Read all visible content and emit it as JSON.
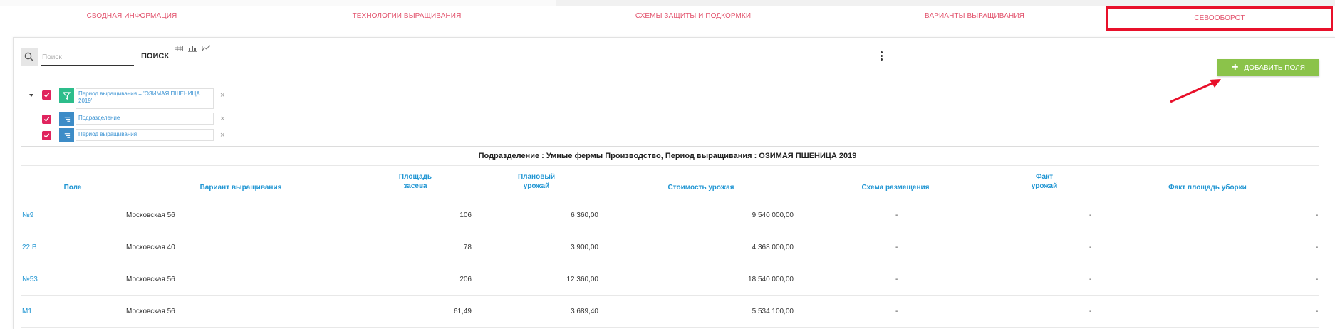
{
  "tabs": [
    {
      "label": "Сводная информация",
      "active": false
    },
    {
      "label": "Технологии выращивания",
      "active": false
    },
    {
      "label": "Схемы защиты и подкормки",
      "active": false
    },
    {
      "label": "Варианты выращивания",
      "active": false
    },
    {
      "label": "Севооборот",
      "active": true
    }
  ],
  "toolbar": {
    "search_placeholder": "Поиск",
    "search_value": "",
    "search_label": "ПОИСК",
    "add_label": "ДОБАВИТЬ ПОЛЯ"
  },
  "filters": [
    {
      "text": "Период выращивания = 'ОЗИМАЯ ПШЕНИЦА 2019'",
      "icon": "filter-icon",
      "checked": true
    },
    {
      "text": "Подразделение",
      "icon": "group-icon",
      "checked": true
    },
    {
      "text": "Период выращивания",
      "icon": "group-icon",
      "checked": true
    }
  ],
  "group_title": "Подразделение : Умные фермы Производство, Период выращивания : ОЗИМАЯ ПШЕНИЦА 2019",
  "table": {
    "columns": [
      {
        "l1": "Поле",
        "l2": ""
      },
      {
        "l1": "Вариант выращивания",
        "l2": ""
      },
      {
        "l1": "Площадь",
        "l2": "засева"
      },
      {
        "l1": "Плановый",
        "l2": "урожай"
      },
      {
        "l1": "Стоимость урожая",
        "l2": ""
      },
      {
        "l1": "Схема размещения",
        "l2": ""
      },
      {
        "l1": "Факт",
        "l2": "урожай"
      },
      {
        "l1": "Факт площадь уборки",
        "l2": ""
      }
    ],
    "rows": [
      [
        "№9",
        "Московская 56",
        "106",
        "6 360,00",
        "9 540 000,00",
        "-",
        "-",
        "-"
      ],
      [
        "22 В",
        "Московская 40",
        "78",
        "3 900,00",
        "4 368 000,00",
        "-",
        "-",
        "-"
      ],
      [
        "№53",
        "Московская 56",
        "206",
        "12 360,00",
        "18 540 000,00",
        "-",
        "-",
        "-"
      ],
      [
        "М1",
        "Московская 56",
        "61,49",
        "3 689,40",
        "5 534 100,00",
        "-",
        "-",
        "-"
      ]
    ]
  },
  "colors": {
    "tab_text": "#e2536d",
    "active_tab_border": "#e8102a",
    "add_button": "#8bc34a",
    "link": "#2196d3",
    "checkbox": "#e0245e",
    "annotation_arrow": "#e8102a"
  }
}
